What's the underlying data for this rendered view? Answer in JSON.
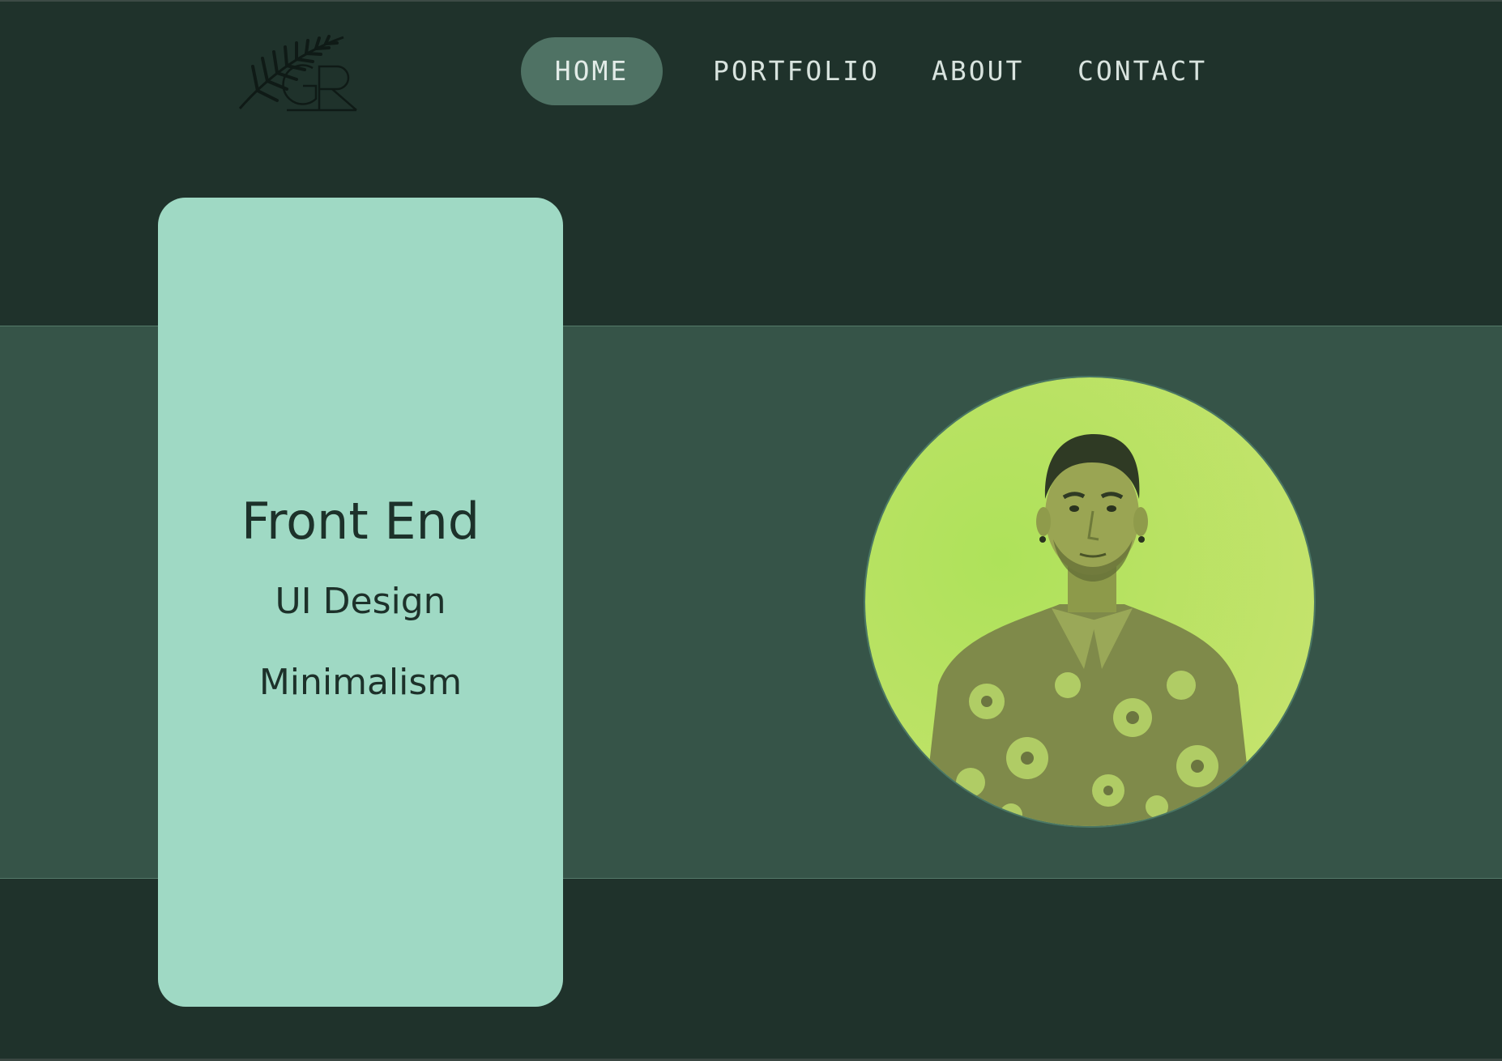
{
  "logo": {
    "icon": "fern-monogram-logo",
    "monogram": "GR"
  },
  "nav": {
    "items": [
      {
        "label": "HOME",
        "active": true
      },
      {
        "label": "PORTFOLIO",
        "active": false
      },
      {
        "label": "ABOUT",
        "active": false
      },
      {
        "label": "CONTACT",
        "active": false
      }
    ]
  },
  "hero": {
    "card": {
      "lines": [
        "Front End",
        "UI Design",
        "Minimalism"
      ]
    },
    "portrait": {
      "image": "profile-photo-man-floral-shirt"
    }
  },
  "colors": {
    "background": "#1f322b",
    "band": "#365448",
    "card": "#9fd9c4",
    "nav_active": "#4f7264",
    "photo_tint": "#b9e06a"
  }
}
